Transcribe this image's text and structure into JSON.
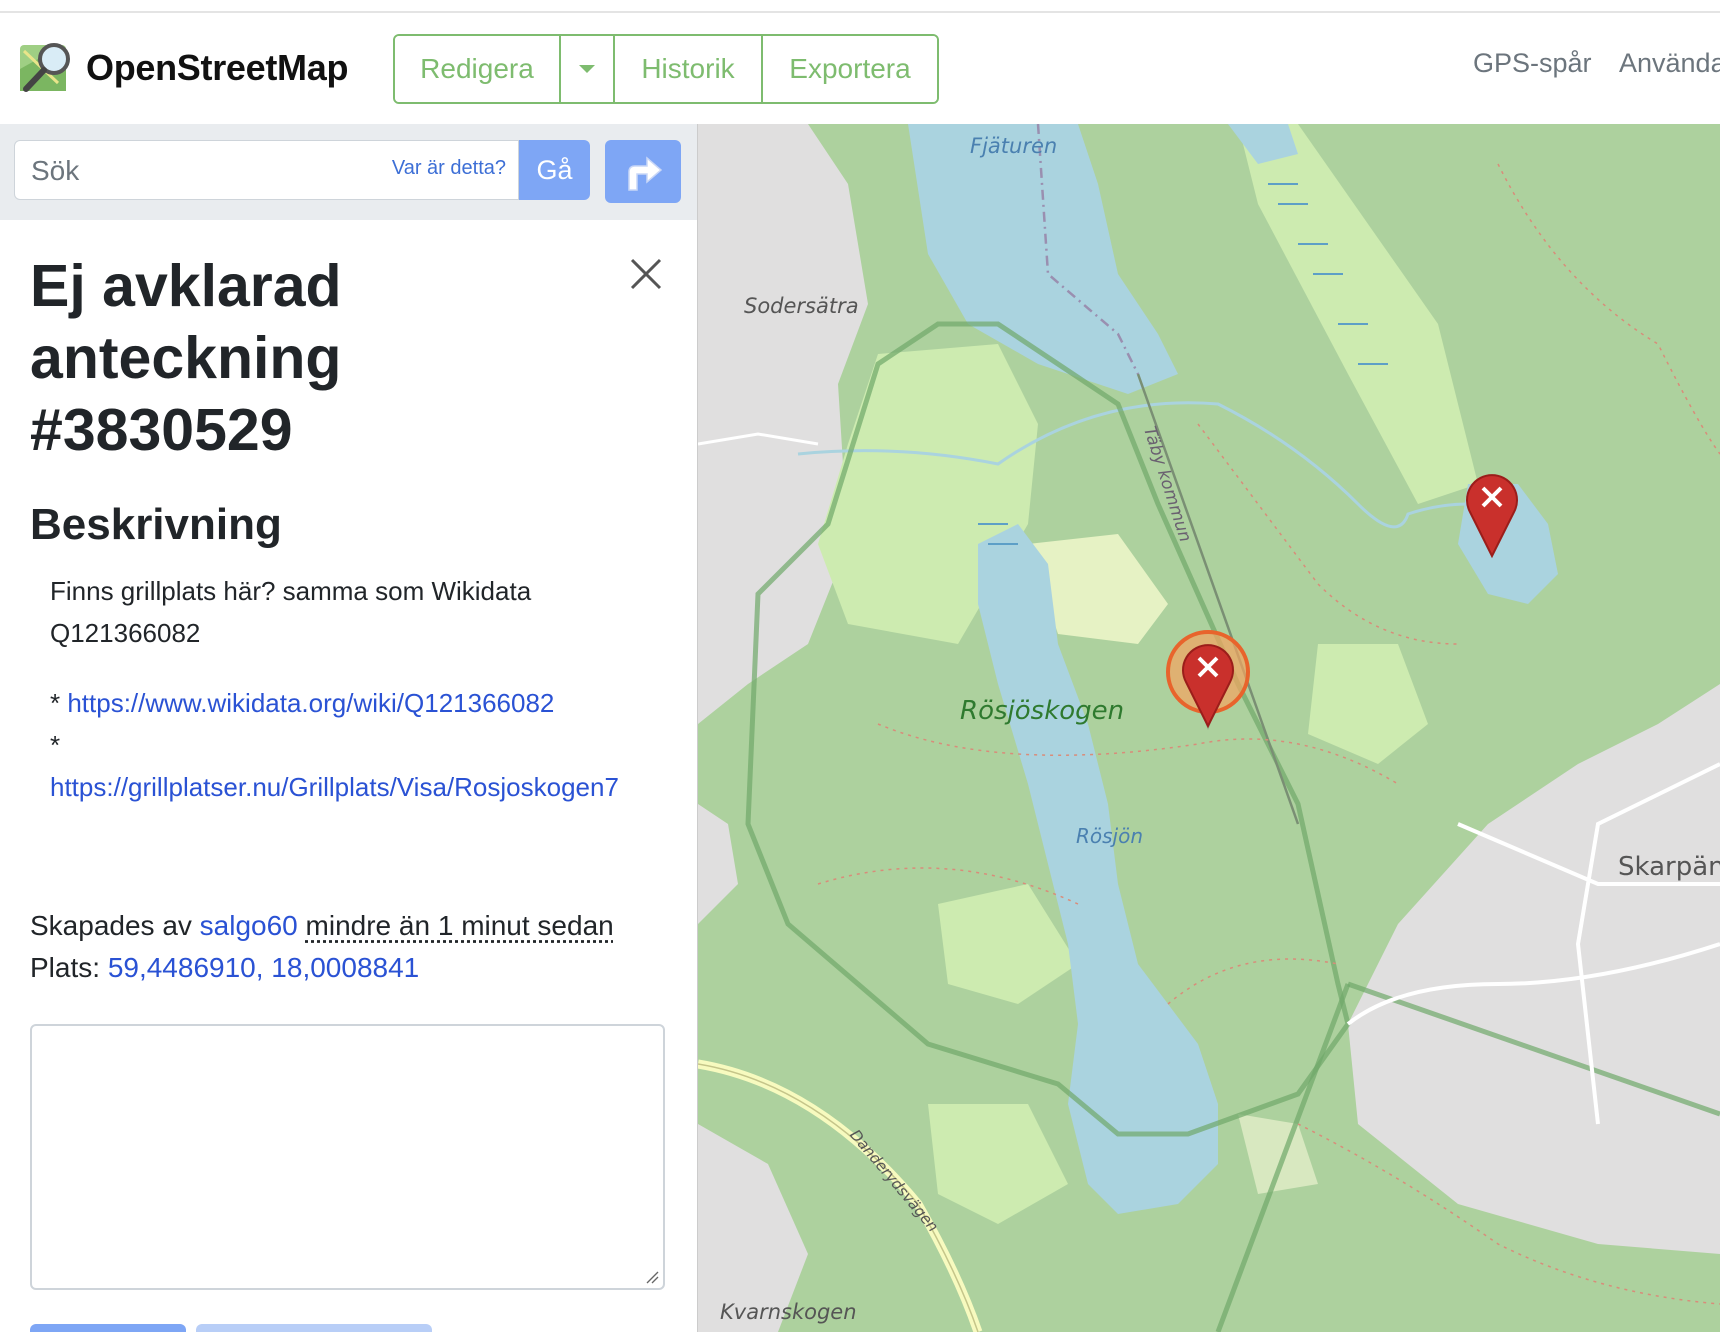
{
  "header": {
    "brand": "OpenStreetMap",
    "buttons": {
      "edit": "Redigera",
      "history": "Historik",
      "export": "Exportera"
    },
    "nav": {
      "gps": "GPS-spår",
      "user": "Använda"
    }
  },
  "search": {
    "placeholder": "Sök",
    "where": "Var är detta?",
    "go": "Gå"
  },
  "note": {
    "title": "Ej avklarad anteckning #3830529",
    "description_heading": "Beskrivning",
    "description_line1": "Finns grillplats här? samma som Wikidata Q121366082",
    "bullet1": "* ",
    "link1": "https://www.wikidata.org/wiki/Q121366082",
    "bullet2": "*",
    "link2": "https://grillplatser.nu/Grillplats/Visa/Rosjoskogen7",
    "created_by_prefix": "Skapades av ",
    "author": "salgo60",
    "created_time": "mindre än 1 minut sedan",
    "location_label": "Plats: ",
    "location": "59,4486910, 18,0008841"
  },
  "map": {
    "labels": {
      "fjaturen": "Fjäturen",
      "sodersatra": "Sodersätra",
      "taby": "Täby kommun",
      "rosjoskogen": "Rösjöskogen",
      "rosjon": "Rösjön",
      "skarpa": "Skarpän",
      "danderyd": "Danderydsvägen",
      "kvarnskogen": "Kvarnskogen"
    },
    "colors": {
      "forest": "#add19e",
      "water": "#aad3df",
      "residential": "#e0dfdf",
      "meadow": "#cdebb0",
      "marker": "#c9302c",
      "highlight": "#f4a460"
    }
  }
}
